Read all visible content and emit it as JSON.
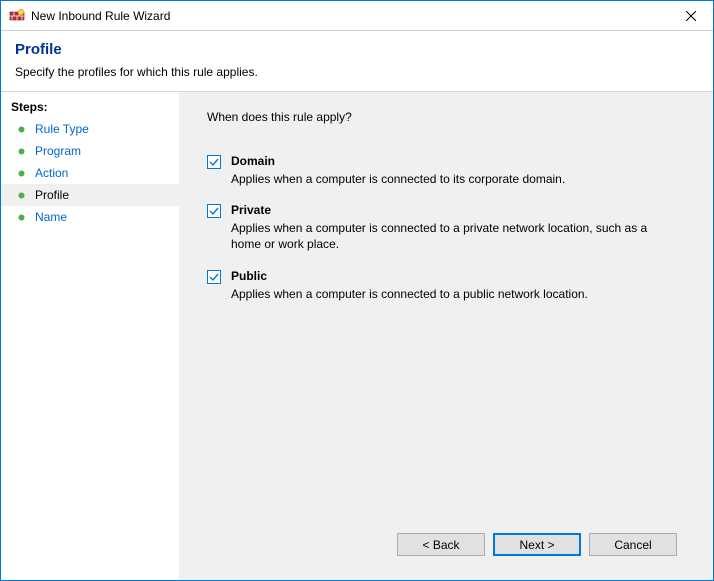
{
  "window": {
    "title": "New Inbound Rule Wizard"
  },
  "header": {
    "title": "Profile",
    "subtitle": "Specify the profiles for which this rule applies."
  },
  "sidebar": {
    "heading": "Steps:",
    "items": [
      {
        "label": "Rule Type",
        "state": "done"
      },
      {
        "label": "Program",
        "state": "done"
      },
      {
        "label": "Action",
        "state": "done"
      },
      {
        "label": "Profile",
        "state": "current"
      },
      {
        "label": "Name",
        "state": "pending"
      }
    ]
  },
  "main": {
    "question": "When does this rule apply?",
    "options": [
      {
        "name": "Domain",
        "checked": true,
        "description": "Applies when a computer is connected to its corporate domain."
      },
      {
        "name": "Private",
        "checked": true,
        "description": "Applies when a computer is connected to a private network location, such as a home or work place."
      },
      {
        "name": "Public",
        "checked": true,
        "description": "Applies when a computer is connected to a public network location."
      }
    ]
  },
  "buttons": {
    "back": "< Back",
    "next": "Next >",
    "cancel": "Cancel"
  }
}
